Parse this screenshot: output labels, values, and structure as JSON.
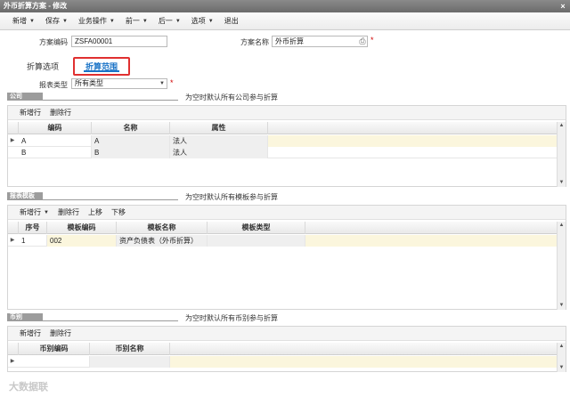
{
  "window": {
    "title": "外币折算方案 - 修改",
    "close": "×"
  },
  "toolbar": {
    "items": [
      {
        "label": "新增",
        "dropdown": true
      },
      {
        "label": "保存",
        "dropdown": true
      },
      {
        "label": "业务操作",
        "dropdown": true
      },
      {
        "label": "前一",
        "dropdown": true
      },
      {
        "label": "后一",
        "dropdown": true
      },
      {
        "label": "选项",
        "dropdown": true
      },
      {
        "label": "退出",
        "dropdown": false
      }
    ]
  },
  "form": {
    "code_label": "方案编码",
    "code_value": "ZSFA00001",
    "name_label": "方案名称",
    "name_value": "外币折算",
    "required_mark": "*"
  },
  "tabs": [
    {
      "label": "折算选项",
      "active": false
    },
    {
      "label": "折算范围",
      "active": true
    }
  ],
  "report_type": {
    "label": "报表类型",
    "value": "所有类型",
    "required_mark": "*"
  },
  "company_section": {
    "tag": "公司",
    "note": "为空时默认所有公司参与折算",
    "actions": [
      "新增行",
      "删除行"
    ],
    "columns": [
      "编码",
      "名称",
      "属性"
    ],
    "rows": [
      {
        "code": "A",
        "name": "A",
        "attr": "法人"
      },
      {
        "code": "B",
        "name": "B",
        "attr": "法人"
      }
    ]
  },
  "template_section": {
    "tag": "报表模板",
    "note": "为空时默认所有模板参与折算",
    "actions": [
      "新增行",
      "删除行",
      "上移",
      "下移"
    ],
    "columns": [
      "序号",
      "模板编码",
      "模板名称",
      "模板类型"
    ],
    "rows": [
      {
        "seq": "1",
        "code": "002",
        "name": "资产负债表（外币折算）",
        "type": ""
      }
    ]
  },
  "currency_section": {
    "tag": "币别",
    "note": "为空时默认所有币别参与折算",
    "actions": [
      "新增行",
      "删除行"
    ],
    "columns": [
      "币别编码",
      "币别名称"
    ],
    "rows": [
      {
        "code": "",
        "name": ""
      }
    ]
  },
  "watermark": "大数据联",
  "colors": {
    "accent": "#1a73c7",
    "highlight_border": "#e03030",
    "row_cream": "#fbf6dd"
  }
}
